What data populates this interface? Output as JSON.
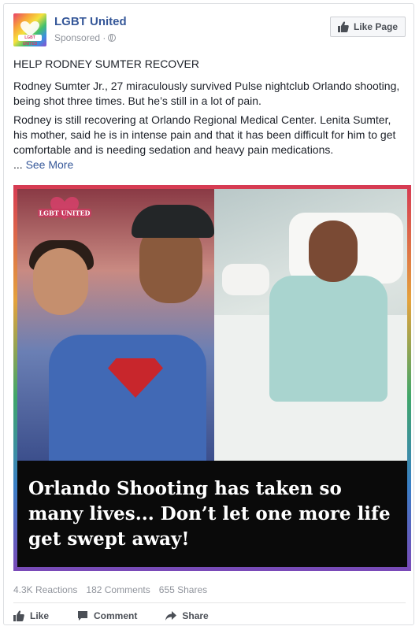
{
  "post": {
    "page_name": "LGBT United",
    "sponsored": "Sponsored ·",
    "like_page_label": "Like Page",
    "headline": "HELP RODNEY SUMTER RECOVER",
    "paragraph_1": "Rodney Sumter Jr., 27 miraculously survived Pulse nightclub Orlando shooting, being shot three times. But he’s still in a lot of pain.",
    "paragraph_2": "Rodney is still recovering at Orlando Regional Medical Center. Lenita Sumter, his mother, said he is in intense pain and that it has been difficult for him to get comfortable and is needing sedation and heavy pain medications.",
    "ellipsis": "...",
    "see_more": "See More",
    "avatar_text": "LGBT UNITED",
    "image_caption": "Orlando Shooting has taken so many lives... Don’t let one more life get swept away!",
    "watermark_text": "LGBT UNITED"
  },
  "stats": {
    "reactions": "4.3K Reactions",
    "comments": "182 Comments",
    "shares": "655 Shares"
  },
  "actions": {
    "like": "Like",
    "comment": "Comment",
    "share": "Share"
  },
  "colors": {
    "link": "#365899",
    "meta": "#90949c",
    "action": "#4b4f56"
  },
  "icons": [
    "globe-icon",
    "thumbs-up-icon",
    "comment-icon",
    "share-icon",
    "heart-icon"
  ]
}
